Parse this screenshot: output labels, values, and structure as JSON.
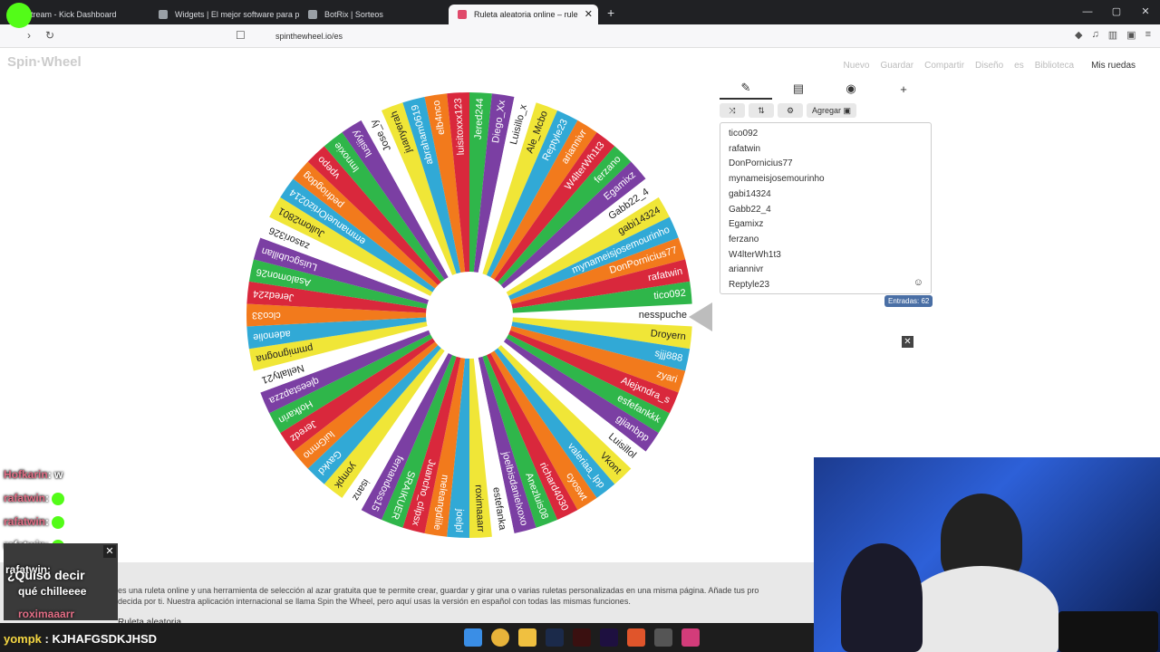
{
  "browser": {
    "tabs": [
      {
        "label": "Stream - Kick Dashboard",
        "active": false
      },
      {
        "label": "Widgets | El mejor software para pot",
        "active": false
      },
      {
        "label": "BotRix | Sorteos",
        "active": false
      },
      {
        "label": "Ruleta aleatoria online – rule",
        "active": true
      }
    ],
    "url": "spinthewheel.io/es"
  },
  "site": {
    "logo": "Spin·Wheel",
    "nav": {
      "nuevo": "Nuevo",
      "guardar": "Guardar",
      "compartir": "Compartir",
      "diseno": "Diseño",
      "lang": "es",
      "biblioteca": "Biblioteca",
      "mis_ruedas": "Mis ruedas"
    }
  },
  "panel": {
    "agregar_label": "Agregar",
    "entries_count": "Entradas: 62",
    "entries": [
      "tico092",
      "rafatwin",
      "DonPornicius77",
      "mynameisjosemourinho",
      "gabi14324",
      "Gabb22_4",
      "Egamixz",
      "ferzano",
      "W4lterWh1t3",
      "ariannivr",
      "Reptyle23"
    ]
  },
  "wheel": {
    "colors": [
      "#ffffff",
      "#f0e637",
      "#31a9d6",
      "#f27a1c",
      "#d9283c",
      "#2fb64a",
      "#7b3fa3"
    ],
    "labels": [
      "nesspuche",
      "Droyern",
      "sjjj888",
      "zyari",
      "Alejxndra_s",
      "esfefankkk",
      "gjianbpp",
      "Luisillol",
      "Vkont",
      "valeriaa_lpp",
      "cyoswt",
      "richard4030",
      "Anezluis08",
      "joelbisdanielxoxo",
      "estefanka",
      "roximaaarr",
      "joelpl",
      "meleangdiile",
      "Juancho_clipsx",
      "SRAIKUER",
      "fernandoss15",
      "isanz",
      "yompk",
      "Gavkd",
      "luiGmno",
      "Jeredz",
      "Hofkarin",
      "qleestapzza",
      "Nellalty21",
      "pmmignogna",
      "adenolie",
      "clco33",
      "Jeredz24",
      "Asalomon26",
      "Luisgcubillan",
      "zasori326",
      "Jullom2801",
      "emmanuelOrtiz0214",
      "pedriogdog",
      "vpepo",
      "lmnoxie",
      "lusiiiyy",
      "Jose_ly",
      "juanyerah",
      "abraham0619",
      "elb4nco",
      "luisitoxxx123",
      "Jered244",
      "Diego_Xx",
      "Luisillo_x",
      "Ale_Mcbo",
      "Reptyle23",
      "ariannivr",
      "W4lterWh1t3",
      "ferzano",
      "Egamixz",
      "Gabb22_4",
      "gabi14324",
      "mynameisjosemourinho",
      "DonPornicius77",
      "rafatwin",
      "tico092"
    ]
  },
  "page": {
    "description": "es una ruleta online y una herramienta de selección al azar gratuita que te permite crear, guardar y girar una o varias ruletas personalizadas en una misma página. Añade tus pro",
    "description2": "decida por ti. Nuestra aplicación internacional se llama Spin the Wheel, pero aquí usas la versión en español con todas las mismas funciones.",
    "section_heading": "Ruleta aleatoria"
  },
  "chat": {
    "lines": [
      {
        "name": "Hofkarin",
        "text": ": w"
      },
      {
        "name": "rafatwin",
        "text": ":"
      },
      {
        "name": "rafatwin",
        "text": ":"
      },
      {
        "name": "rafatwin",
        "text": ":"
      },
      {
        "name": "rafatwin",
        "text": ":"
      }
    ],
    "popup_line1": "¿Quiso decir",
    "popup_line2": "qué chilleeee",
    "popup_line3_name": "roximaaarr",
    "bottom_name": "yompk",
    "bottom_text": ": KJHAFGSDKJHSD"
  }
}
